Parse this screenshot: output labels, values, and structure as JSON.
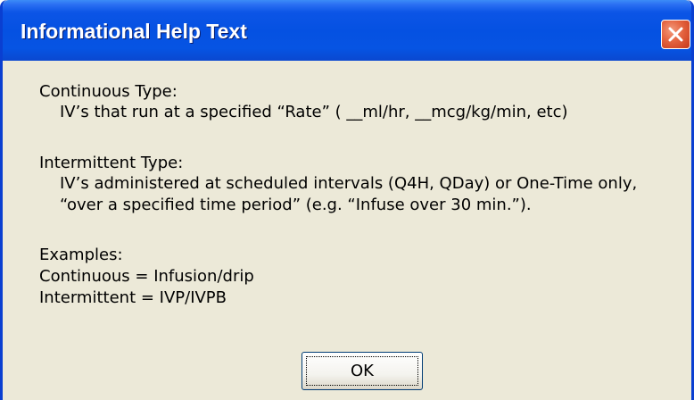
{
  "dialog": {
    "title": "Informational Help Text",
    "close_icon": "close-icon",
    "colors": {
      "titlebar": "#0551e2",
      "body": "#ece9d8",
      "close_button": "#e4633f"
    }
  },
  "content": {
    "continuous_heading": "Continuous Type:",
    "continuous_desc": "IV’s that run at a specified “Rate” ( __ml/hr, __mcg/kg/min, etc)",
    "intermittent_heading": "Intermittent Type:",
    "intermittent_desc_1": "IV’s administered at scheduled intervals (Q4H, QDay) or One-Time only,",
    "intermittent_desc_2": "“over a specified time period” (e.g. “Infuse over 30 min.”).",
    "examples_heading": "Examples:",
    "example_continuous": "Continuous = Infusion/drip",
    "example_intermittent": "Intermittent = IVP/IVPB"
  },
  "buttons": {
    "ok_label": "OK"
  }
}
